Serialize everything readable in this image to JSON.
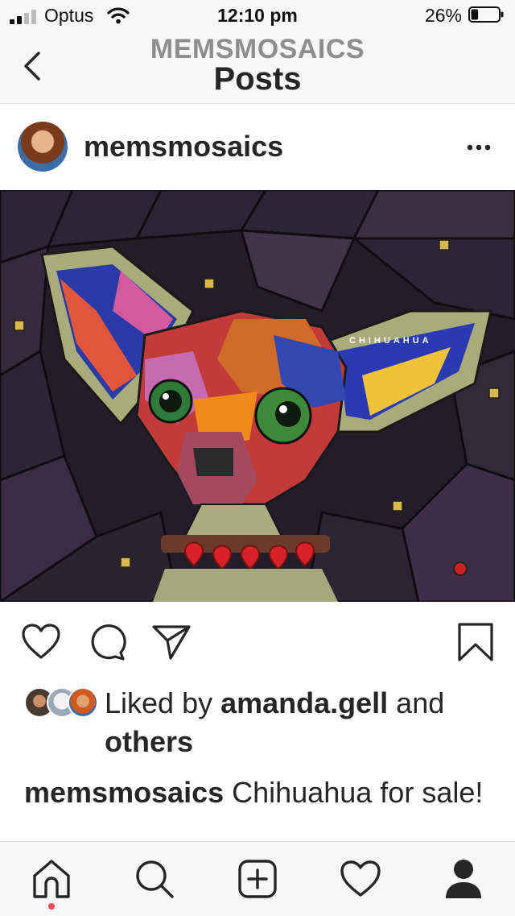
{
  "status_bar": {
    "carrier": "Optus",
    "time": "12:10 pm",
    "battery_percent": "26%",
    "battery_level": 0.26
  },
  "nav": {
    "account": "MEMSMOSAICS",
    "title": "Posts"
  },
  "post": {
    "username": "memsmosaics",
    "image_text": "CHIHUAHUA",
    "likes": {
      "prefix": "Liked by ",
      "user": "amanda.gell",
      "middle": " and",
      "others": "others"
    },
    "caption": {
      "username": "memsmosaics",
      "text": " Chihuahua for sale!"
    }
  },
  "icons": {
    "status": [
      "signal-icon",
      "wifi-icon",
      "battery-icon"
    ],
    "nav": [
      "back-chevron-icon"
    ],
    "post": [
      "more-options-icon",
      "heart-icon",
      "comment-icon",
      "share-icon",
      "bookmark-icon"
    ],
    "tabbar": [
      "home-icon",
      "search-icon",
      "add-post-icon",
      "activity-heart-icon",
      "profile-icon"
    ]
  },
  "colors": {
    "notification_dot": "#ed4956",
    "secondary_text": "#8e8e8e"
  }
}
